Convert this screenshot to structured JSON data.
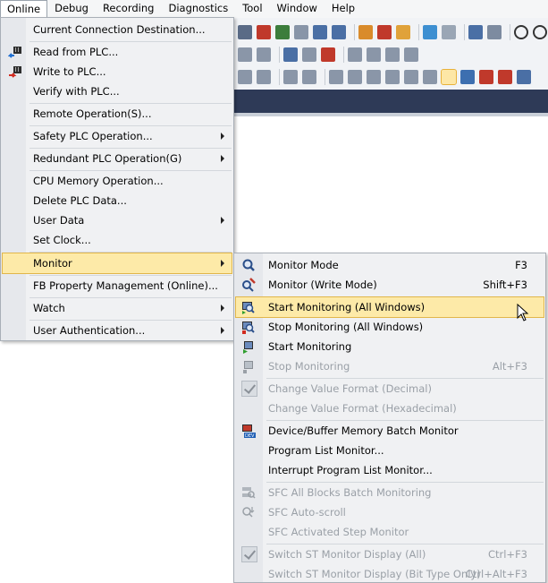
{
  "menubar": {
    "items": [
      "Online",
      "Debug",
      "Recording",
      "Diagnostics",
      "Tool",
      "Window",
      "Help"
    ]
  },
  "online_menu": {
    "items": [
      {
        "label": "Current Connection Destination...",
        "icon": "",
        "submenu": false
      },
      {
        "label": "Read from PLC...",
        "icon": "read-from-plc-icon",
        "submenu": false
      },
      {
        "label": "Write to PLC...",
        "icon": "write-to-plc-icon",
        "submenu": false
      },
      {
        "label": "Verify with PLC...",
        "icon": "",
        "submenu": false
      },
      {
        "label": "Remote Operation(S)...",
        "icon": "",
        "submenu": false
      },
      {
        "label": "Safety PLC Operation...",
        "icon": "",
        "submenu": true
      },
      {
        "label": "Redundant PLC Operation(G)",
        "icon": "",
        "submenu": true
      },
      {
        "label": "CPU Memory Operation...",
        "icon": "",
        "submenu": false
      },
      {
        "label": "Delete PLC Data...",
        "icon": "",
        "submenu": false
      },
      {
        "label": "User Data",
        "icon": "",
        "submenu": true
      },
      {
        "label": "Set Clock...",
        "icon": "",
        "submenu": false
      },
      {
        "label": "Monitor",
        "icon": "",
        "submenu": true,
        "selected": true
      },
      {
        "label": "FB Property Management (Online)...",
        "icon": "",
        "submenu": false
      },
      {
        "label": "Watch",
        "icon": "",
        "submenu": true
      },
      {
        "label": "User Authentication...",
        "icon": "",
        "submenu": true
      }
    ]
  },
  "monitor_submenu": {
    "items": [
      {
        "label": "Monitor Mode",
        "shortcut": "F3",
        "icon": "monitor-mode-icon",
        "disabled": false
      },
      {
        "label": "Monitor (Write Mode)",
        "shortcut": "Shift+F3",
        "icon": "monitor-write-mode-icon",
        "disabled": false
      },
      {
        "label": "Start Monitoring (All Windows)",
        "shortcut": "",
        "icon": "start-monitoring-all-icon",
        "disabled": false,
        "selected": true
      },
      {
        "label": "Stop Monitoring (All Windows)",
        "shortcut": "",
        "icon": "stop-monitoring-all-icon",
        "disabled": false
      },
      {
        "label": "Start Monitoring",
        "shortcut": "",
        "icon": "start-monitoring-icon",
        "disabled": false
      },
      {
        "label": "Stop Monitoring",
        "shortcut": "Alt+F3",
        "icon": "stop-monitoring-icon",
        "disabled": true
      },
      {
        "label": "Change Value Format (Decimal)",
        "shortcut": "",
        "icon": "checkmark-icon",
        "disabled": true
      },
      {
        "label": "Change Value Format (Hexadecimal)",
        "shortcut": "",
        "icon": "",
        "disabled": true
      },
      {
        "label": "Device/Buffer Memory Batch Monitor",
        "shortcut": "",
        "icon": "device-batch-monitor-icon",
        "disabled": false
      },
      {
        "label": "Program List Monitor...",
        "shortcut": "",
        "icon": "",
        "disabled": false
      },
      {
        "label": "Interrupt Program List Monitor...",
        "shortcut": "",
        "icon": "",
        "disabled": false
      },
      {
        "label": "SFC All Blocks Batch Monitoring",
        "shortcut": "",
        "icon": "sfc-batch-icon",
        "disabled": true
      },
      {
        "label": "SFC Auto-scroll",
        "shortcut": "",
        "icon": "sfc-autoscroll-icon",
        "disabled": true
      },
      {
        "label": "SFC Activated Step Monitor",
        "shortcut": "",
        "icon": "",
        "disabled": true
      },
      {
        "label": "Switch ST Monitor Display (All)",
        "shortcut": "Ctrl+F3",
        "icon": "checkmark-icon",
        "disabled": true
      },
      {
        "label": "Switch ST Monitor Display (Bit Type Only)",
        "shortcut": "Ctrl+Alt+F3",
        "icon": "",
        "disabled": true
      }
    ]
  },
  "colors": {
    "menubar_bg": "#f5f6f7",
    "menu_bg": "#f0f1f3",
    "highlight": "#fdeaa8",
    "highlight_border": "#e1b64b",
    "disabled_text": "#9aa0a7",
    "dark_bar": "#2e3a57"
  }
}
